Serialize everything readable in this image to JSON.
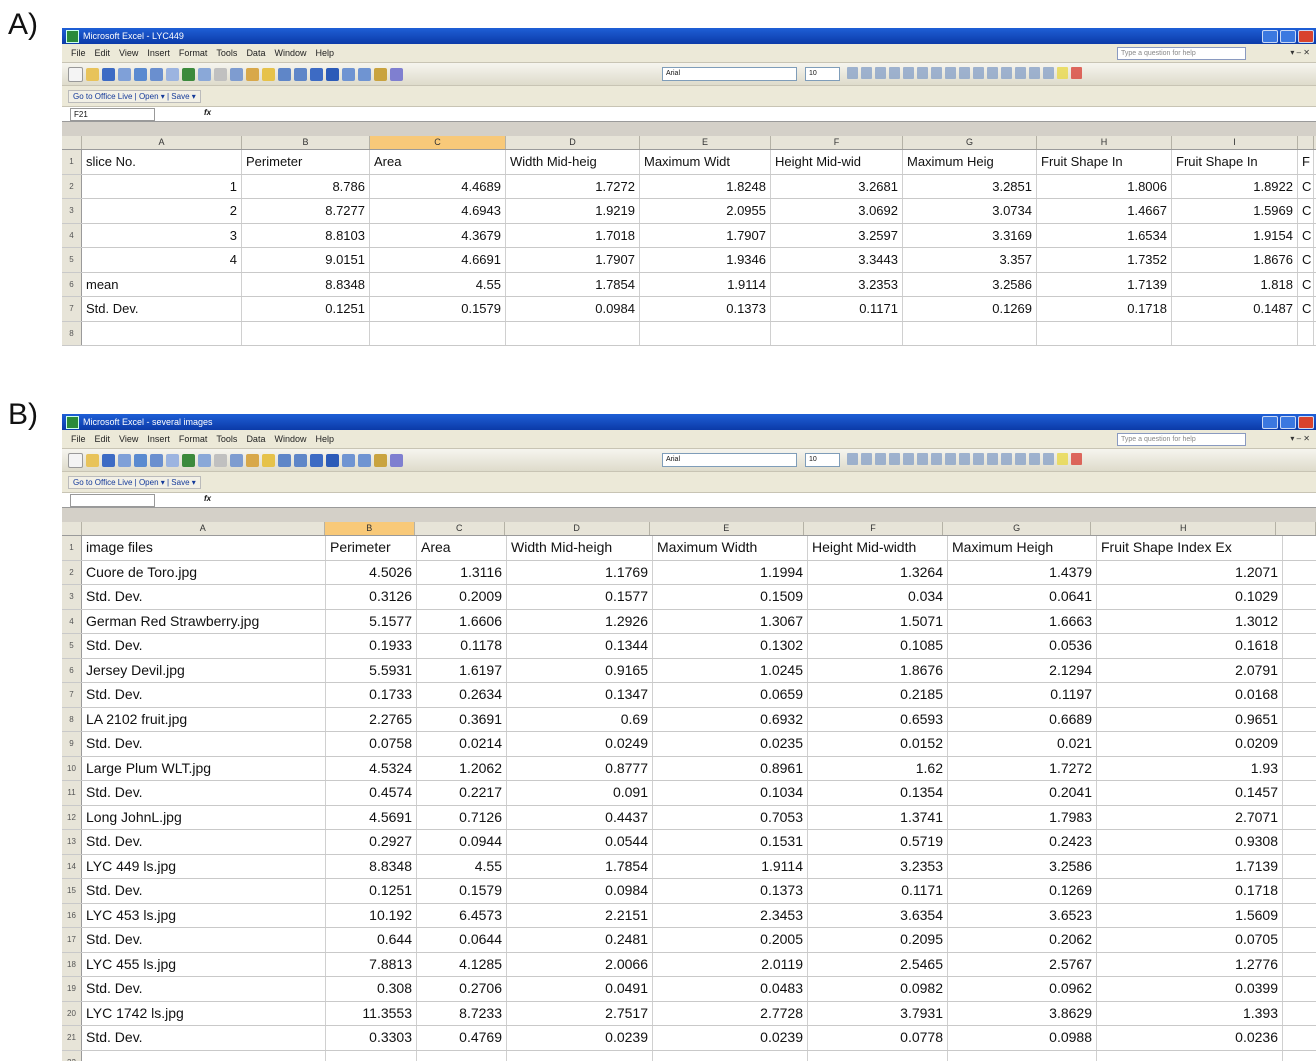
{
  "panels": {
    "a_label": "A)",
    "b_label": "B)"
  },
  "window_a": {
    "title": "Microsoft Excel - LYC449",
    "menu": [
      "File",
      "Edit",
      "View",
      "Insert",
      "Format",
      "Tools",
      "Data",
      "Window",
      "Help"
    ],
    "ask_placeholder": "Type a question for help",
    "font_name": "Arial",
    "font_size": "10",
    "link_bar_label": "Go to Office Live | Open ▾ | Save ▾",
    "name_box": "F21",
    "fx": "fx",
    "col_headers": [
      "A",
      "B",
      "C",
      "D",
      "E",
      "F",
      "G",
      "H",
      "I",
      ""
    ],
    "selected_col": 2,
    "rows": [
      [
        "1",
        "slice No.",
        "Perimeter",
        "Area",
        "Width Mid-heig",
        "Maximum Widt",
        "Height Mid-wid",
        "Maximum Heig",
        "Fruit Shape In",
        "Fruit Shape In",
        "F"
      ],
      [
        "2",
        "1",
        "8.786",
        "4.4689",
        "1.7272",
        "1.8248",
        "3.2681",
        "3.2851",
        "1.8006",
        "1.8922",
        "C"
      ],
      [
        "3",
        "2",
        "8.7277",
        "4.6943",
        "1.9219",
        "2.0955",
        "3.0692",
        "3.0734",
        "1.4667",
        "1.5969",
        "C"
      ],
      [
        "4",
        "3",
        "8.8103",
        "4.3679",
        "1.7018",
        "1.7907",
        "3.2597",
        "3.3169",
        "1.6534",
        "1.9154",
        "C"
      ],
      [
        "5",
        "4",
        "9.0151",
        "4.6691",
        "1.7907",
        "1.9346",
        "3.3443",
        "3.357",
        "1.7352",
        "1.8676",
        "C"
      ],
      [
        "6",
        "mean",
        "8.8348",
        "4.55",
        "1.7854",
        "1.9114",
        "3.2353",
        "3.2586",
        "1.7139",
        "1.818",
        "C"
      ],
      [
        "7",
        "Std. Dev.",
        "0.1251",
        "0.1579",
        "0.0984",
        "0.1373",
        "0.1171",
        "0.1269",
        "0.1718",
        "0.1487",
        "C"
      ],
      [
        "8",
        "",
        "",
        "",
        "",
        "",
        "",
        "",
        "",
        "",
        ""
      ]
    ]
  },
  "window_b": {
    "title": "Microsoft Excel - several images",
    "menu": [
      "File",
      "Edit",
      "View",
      "Insert",
      "Format",
      "Tools",
      "Data",
      "Window",
      "Help"
    ],
    "ask_placeholder": "Type a question for help",
    "font_name": "Arial",
    "font_size": "10",
    "link_bar_label": "Go to Office Live | Open ▾ | Save ▾",
    "name_box": "",
    "fx": "fx",
    "col_headers": [
      "A",
      "B",
      "C",
      "D",
      "E",
      "F",
      "G",
      "H",
      ""
    ],
    "selected_col": 1,
    "rows": [
      [
        "1",
        "image files",
        "Perimeter",
        "Area",
        "Width Mid-heigh",
        "Maximum Width",
        "Height Mid-width",
        "Maximum Heigh",
        "Fruit Shape Index Ex"
      ],
      [
        "2",
        "Cuore de Toro.jpg",
        "4.5026",
        "1.3116",
        "1.1769",
        "1.1994",
        "1.3264",
        "1.4379",
        "1.2071"
      ],
      [
        "3",
        "Std. Dev.",
        "0.3126",
        "0.2009",
        "0.1577",
        "0.1509",
        "0.034",
        "0.0641",
        "0.1029"
      ],
      [
        "4",
        "German Red Strawberry.jpg",
        "5.1577",
        "1.6606",
        "1.2926",
        "1.3067",
        "1.5071",
        "1.6663",
        "1.3012"
      ],
      [
        "5",
        "Std. Dev.",
        "0.1933",
        "0.1178",
        "0.1344",
        "0.1302",
        "0.1085",
        "0.0536",
        "0.1618"
      ],
      [
        "6",
        "Jersey Devil.jpg",
        "5.5931",
        "1.6197",
        "0.9165",
        "1.0245",
        "1.8676",
        "2.1294",
        "2.0791"
      ],
      [
        "7",
        "Std. Dev.",
        "0.1733",
        "0.2634",
        "0.1347",
        "0.0659",
        "0.2185",
        "0.1197",
        "0.0168"
      ],
      [
        "8",
        "LA 2102 fruit.jpg",
        "2.2765",
        "0.3691",
        "0.69",
        "0.6932",
        "0.6593",
        "0.6689",
        "0.9651"
      ],
      [
        "9",
        "Std. Dev.",
        "0.0758",
        "0.0214",
        "0.0249",
        "0.0235",
        "0.0152",
        "0.021",
        "0.0209"
      ],
      [
        "10",
        "Large Plum WLT.jpg",
        "4.5324",
        "1.2062",
        "0.8777",
        "0.8961",
        "1.62",
        "1.7272",
        "1.93"
      ],
      [
        "11",
        "Std. Dev.",
        "0.4574",
        "0.2217",
        "0.091",
        "0.1034",
        "0.1354",
        "0.2041",
        "0.1457"
      ],
      [
        "12",
        "Long JohnL.jpg",
        "4.5691",
        "0.7126",
        "0.4437",
        "0.7053",
        "1.3741",
        "1.7983",
        "2.7071"
      ],
      [
        "13",
        "Std. Dev.",
        "0.2927",
        "0.0944",
        "0.0544",
        "0.1531",
        "0.5719",
        "0.2423",
        "0.9308"
      ],
      [
        "14",
        "LYC 449 ls.jpg",
        "8.8348",
        "4.55",
        "1.7854",
        "1.9114",
        "3.2353",
        "3.2586",
        "1.7139"
      ],
      [
        "15",
        "Std. Dev.",
        "0.1251",
        "0.1579",
        "0.0984",
        "0.1373",
        "0.1171",
        "0.1269",
        "0.1718"
      ],
      [
        "16",
        "LYC 453 ls.jpg",
        "10.192",
        "6.4573",
        "2.2151",
        "2.3453",
        "3.6354",
        "3.6523",
        "1.5609"
      ],
      [
        "17",
        "Std. Dev.",
        "0.644",
        "0.0644",
        "0.2481",
        "0.2005",
        "0.2095",
        "0.2062",
        "0.0705"
      ],
      [
        "18",
        "LYC 455 ls.jpg",
        "7.8813",
        "4.1285",
        "2.0066",
        "2.0119",
        "2.5465",
        "2.5767",
        "1.2776"
      ],
      [
        "19",
        "Std. Dev.",
        "0.308",
        "0.2706",
        "0.0491",
        "0.0483",
        "0.0982",
        "0.0962",
        "0.0399"
      ],
      [
        "20",
        "LYC 1742 ls.jpg",
        "11.3553",
        "8.7233",
        "2.7517",
        "2.7728",
        "3.7931",
        "3.8629",
        "1.393"
      ],
      [
        "21",
        "Std. Dev.",
        "0.3303",
        "0.4769",
        "0.0239",
        "0.0239",
        "0.0778",
        "0.0988",
        "0.0236"
      ],
      [
        "22",
        "",
        "",
        "",
        "",
        "",
        "",
        "",
        ""
      ]
    ]
  },
  "colors": {
    "titlebar": "#0b3aa8",
    "selected_header": "#f8c979",
    "chrome": "#ece9d8"
  }
}
